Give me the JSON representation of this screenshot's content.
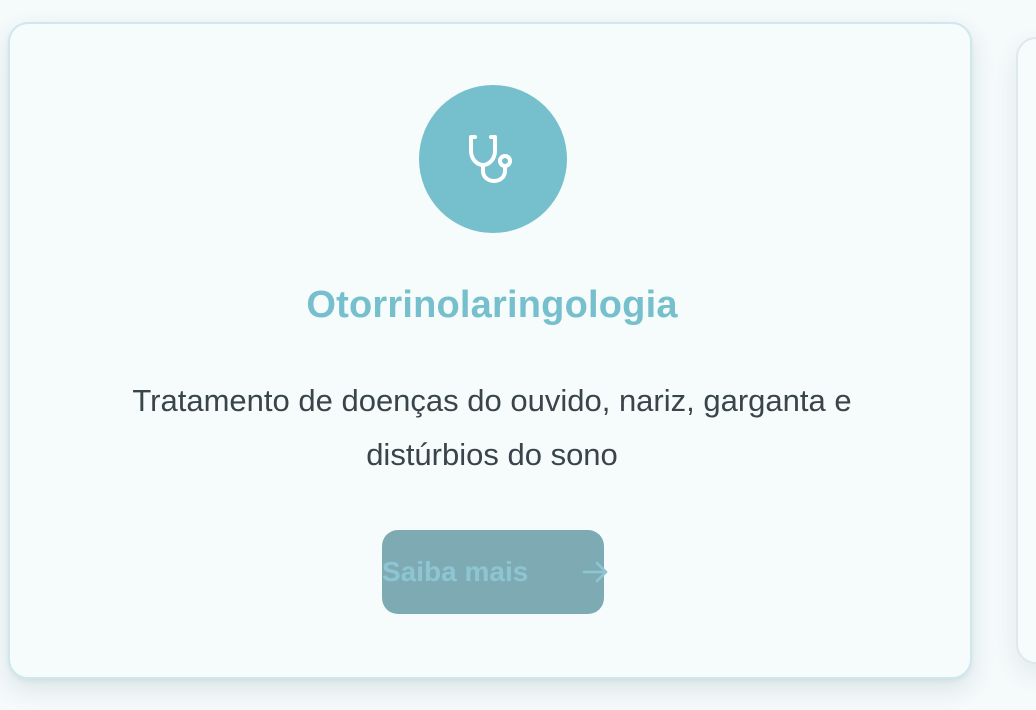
{
  "card": {
    "icon": "stethoscope-icon",
    "title": "Otorrinolaringologia",
    "description": "Tratamento de doenças do ouvido, nariz, garganta e distúrbios do sono",
    "button_label": "Saiba mais",
    "button_icon": "arrow-right-icon"
  },
  "colors": {
    "accent": "#76bfcc",
    "button_bg": "#7eabb3",
    "text": "#3a444b",
    "card_bg": "#f6fcfc",
    "card_border": "#cfe7ee"
  }
}
